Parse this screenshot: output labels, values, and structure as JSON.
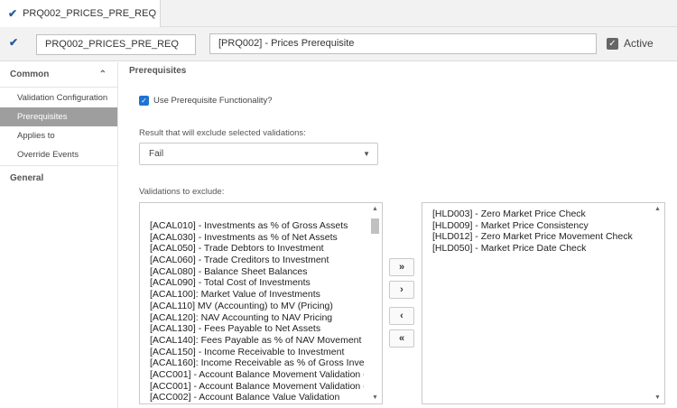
{
  "tab": {
    "title": "PRQ002_PRICES_PRE_REQ",
    "icon": "double-check-icon"
  },
  "toolbar": {
    "icon": "double-check-icon",
    "code_value": "PRQ002_PRICES_PRE_REQ",
    "name_value": "[PRQ002] - Prices Prerequisite",
    "active_label": "Active",
    "active_checked": true
  },
  "sidebar": {
    "common_label": "Common",
    "items": [
      {
        "label": "Validation Configuration"
      },
      {
        "label": "Prerequisites",
        "active": true
      },
      {
        "label": "Applies to"
      },
      {
        "label": "Override Events"
      }
    ],
    "general_label": "General"
  },
  "main": {
    "title": "Prerequisites",
    "use_prereq_label": "Use Prerequisite Functionality?",
    "use_prereq_checked": true,
    "result_label": "Result that will exclude selected validations:",
    "result_value": "Fail",
    "validations_label": "Validations to exclude:",
    "available": [
      "[ACAL010] - Investments as % of Gross Assets",
      "[ACAL030] - Investments as % of Net Assets",
      "[ACAL050] - Trade Debtors to Investment",
      "[ACAL060] - Trade Creditors to Investment",
      "[ACAL080] - Balance Sheet Balances",
      "[ACAL090] - Total Cost of Investments",
      "[ACAL100]: Market Value of Investments",
      "[ACAL110] MV (Accounting) to MV (Pricing)",
      "[ACAL120]: NAV Accounting to NAV Pricing",
      "[ACAL130] - Fees Payable to Net Assets",
      "[ACAL140]: Fees Payable as % of NAV Movement",
      "[ACAL150] - Income Receivable to Investment",
      "[ACAL160]: Income Receivable as % of Gross Inves",
      "[ACC001] - Account Balance Movement Validation (",
      "[ACC001] - Account Balance Movement Validation (",
      "[ACC002] - Account Balance Value Validation"
    ],
    "selected": [
      "[HLD003] - Zero Market Price Check",
      "[HLD009] - Market Price Consistency",
      "[HLD012] - Zero Market Price Movement Check",
      "[HLD050] - Market Price Date Check"
    ],
    "buttons": {
      "move_all_right": "»",
      "move_right": "›",
      "move_left": "‹",
      "move_all_left": "«"
    }
  }
}
